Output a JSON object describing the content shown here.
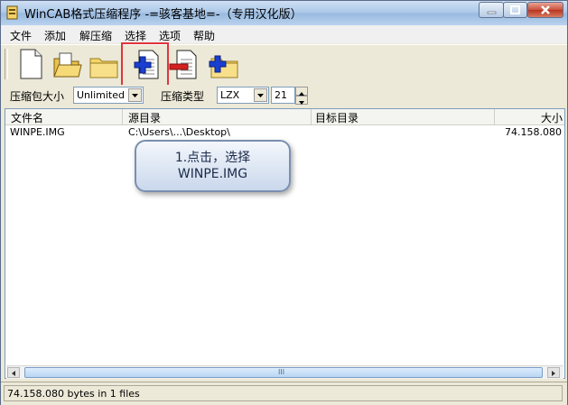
{
  "window": {
    "title": "WinCAB格式压缩程序 -=骇客基地=-（专用汉化版）"
  },
  "menu": [
    "文件",
    "添加",
    "解压缩",
    "选择",
    "选项",
    "帮助"
  ],
  "toolbar": {
    "buttons": [
      "new-archive",
      "open-archive",
      "open-folder",
      "add-files",
      "delete-files",
      "extract-files"
    ]
  },
  "options": {
    "archive_size_label": "压缩包大小",
    "archive_size_value": "Unlimited",
    "compression_type_label": "压缩类型",
    "compression_type_value": "LZX",
    "level_value": "21"
  },
  "list": {
    "columns": [
      "文件名",
      "源目录",
      "目标目录",
      "大小"
    ],
    "rows": [
      {
        "name": "WINPE.IMG",
        "source": "C:\\Users\\...\\Desktop\\",
        "target": "",
        "size": "74.158.080"
      }
    ]
  },
  "callout": {
    "line1": "1.点击，选择",
    "line2": "WINPE.IMG"
  },
  "scrollbar": {
    "grip": "III"
  },
  "status": {
    "text": "74.158.080 bytes in 1 files"
  },
  "colors": {
    "highlight": "#e0353b",
    "accent_blue": "#1a3fcf",
    "accent_red": "#d42020"
  }
}
